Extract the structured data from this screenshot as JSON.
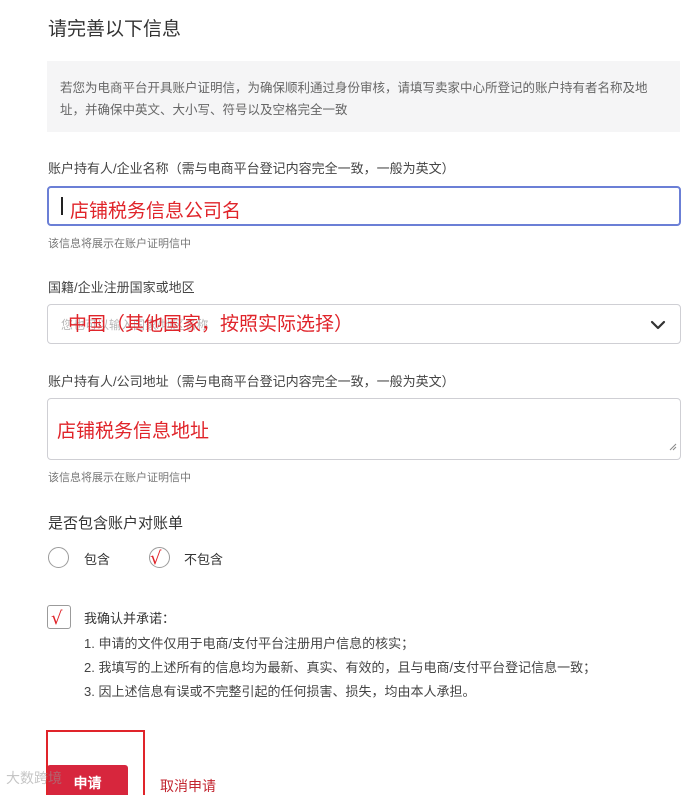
{
  "page": {
    "title": "请完善以下信息",
    "notice": "若您为电商平台开具账户证明信，为确保顺利通过身份审核，请填写卖家中心所登记的账户持有者名称及地址，并确保中英文、大小写、符号以及空格完全一致"
  },
  "holder_name": {
    "label": "账户持有人/企业名称（需与电商平台登记内容完全一致，一般为英文）",
    "value": "",
    "helper": "该信息将展示在账户证明信中",
    "annotation": "店铺税务信息公司名"
  },
  "country": {
    "label": "国籍/企业注册国家或地区",
    "placeholder": "您也可以输入国家/地区名称",
    "annotation": "中国（其他国家，按照实际选择）",
    "icon": "chevron-down-icon"
  },
  "address": {
    "label": "账户持有人/公司地址（需与电商平台登记内容完全一致，一般为英文）",
    "value": "",
    "helper": "该信息将展示在账户证明信中",
    "annotation": "店铺税务信息地址"
  },
  "statement": {
    "title": "是否包含账户对账单",
    "options": [
      "包含",
      "不包含"
    ],
    "selected": "不包含",
    "mark": "√"
  },
  "commitment": {
    "checked": true,
    "mark": "√",
    "head": "我确认并承诺：",
    "lines": [
      "1. 申请的文件仅用于电商/支付平台注册用户信息的核实；",
      "2. 我填写的上述所有的信息均为最新、真实、有效的，且与电商/支付平台登记信息一致；",
      "3. 因上述信息有误或不完整引起的任何损害、损失，均由本人承担。"
    ]
  },
  "actions": {
    "submit": "申请",
    "cancel": "取消申请"
  },
  "watermark": "大数跨境",
  "colors": {
    "accent_red": "#d7263d",
    "annotation_red": "#e0242a",
    "focus_border": "#6b7fd6"
  }
}
